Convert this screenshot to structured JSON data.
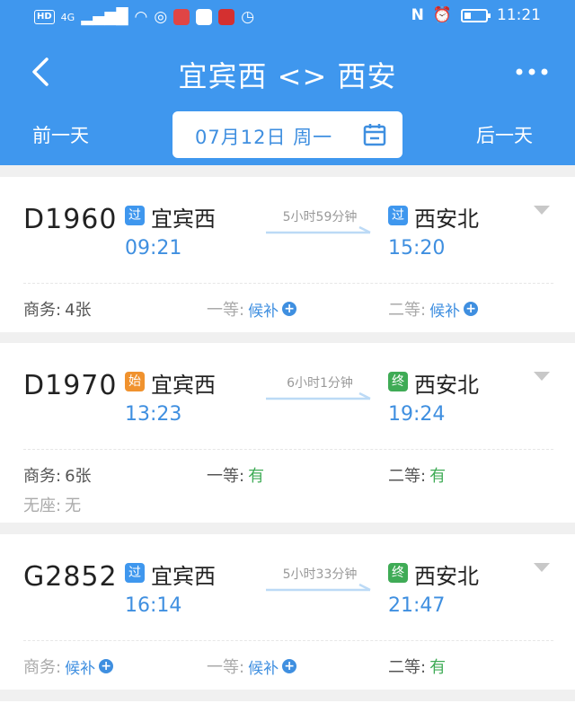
{
  "status_bar": {
    "hd": "HD",
    "net": "4G",
    "time": "11:21"
  },
  "header": {
    "back_label": "‹",
    "title": "宜宾西 <> 西安",
    "more_label": "•••",
    "prev_day": "前一天",
    "next_day": "后一天",
    "date": "07月12日 周一"
  },
  "trains": [
    {
      "number": "D1960",
      "from_tag": "过",
      "from_tag_type": "pass",
      "from": "宜宾西",
      "depart": "09:21",
      "duration": "5小时59分钟",
      "to_tag": "过",
      "to_tag_type": "pass",
      "to": "西安北",
      "arrive": "15:20",
      "seats": [
        {
          "label": "商务:",
          "value": "4张",
          "style": "plain"
        },
        {
          "label": "一等:",
          "value": "候补",
          "style": "waitlist"
        },
        {
          "label": "二等:",
          "value": "候补",
          "style": "waitlist"
        }
      ]
    },
    {
      "number": "D1970",
      "from_tag": "始",
      "from_tag_type": "start",
      "from": "宜宾西",
      "depart": "13:23",
      "duration": "6小时1分钟",
      "to_tag": "终",
      "to_tag_type": "end",
      "to": "西安北",
      "arrive": "19:24",
      "seats": [
        {
          "label": "商务:",
          "value": "6张",
          "style": "plain"
        },
        {
          "label": "一等:",
          "value": "有",
          "style": "green"
        },
        {
          "label": "二等:",
          "value": "有",
          "style": "green"
        },
        {
          "label": "无座:",
          "value": "无",
          "style": "gray"
        }
      ]
    },
    {
      "number": "G2852",
      "from_tag": "过",
      "from_tag_type": "pass",
      "from": "宜宾西",
      "depart": "16:14",
      "duration": "5小时33分钟",
      "to_tag": "终",
      "to_tag_type": "end",
      "to": "西安北",
      "arrive": "21:47",
      "seats": [
        {
          "label": "商务:",
          "value": "候补",
          "style": "waitlist"
        },
        {
          "label": "一等:",
          "value": "候补",
          "style": "waitlist"
        },
        {
          "label": "二等:",
          "value": "有",
          "style": "green"
        }
      ]
    }
  ],
  "colors": {
    "brand_blue": "#3f97ee",
    "available_green": "#3fab56",
    "start_orange": "#f0922e"
  }
}
